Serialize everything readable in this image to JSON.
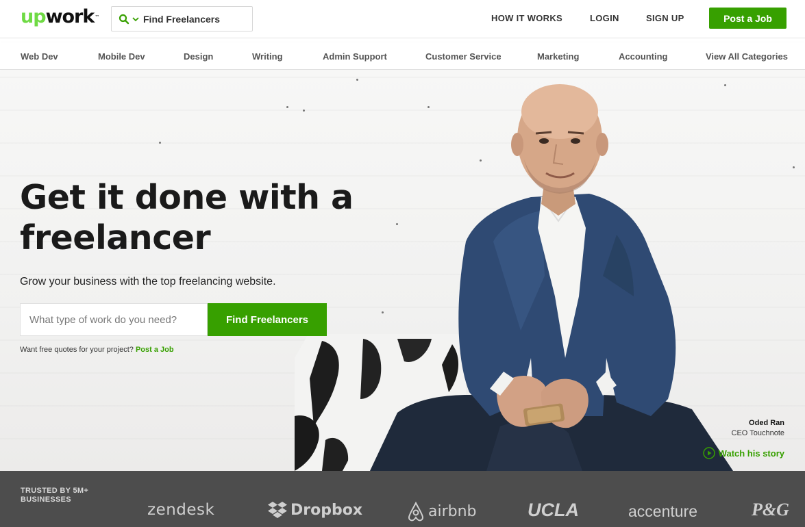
{
  "header": {
    "logo_up": "up",
    "logo_work": "work",
    "logo_tm": "™",
    "search_selector_label": "Find Freelancers",
    "nav": {
      "how_it_works": "HOW IT WORKS",
      "login": "LOGIN",
      "sign_up": "SIGN UP"
    },
    "post_job_label": "Post a Job"
  },
  "categories": [
    "Web Dev",
    "Mobile Dev",
    "Design",
    "Writing",
    "Admin Support",
    "Customer Service",
    "Marketing",
    "Accounting",
    "View All Categories"
  ],
  "hero": {
    "title": "Get it done with a freelancer",
    "subtitle": "Grow your business with the top freelancing website.",
    "search_placeholder": "What type of work do you need?",
    "search_button": "Find Freelancers",
    "quote_text": "Want free quotes for your project?",
    "quote_link": "Post a Job",
    "caption_name": "Oded Ran",
    "caption_role": "CEO Touchnote",
    "watch_label": "Watch his story"
  },
  "trusted": {
    "label": "TRUSTED BY 5M+ BUSINESSES",
    "brands": [
      "zendesk",
      "Dropbox",
      "airbnb",
      "UCLA",
      "accenture",
      "P&G"
    ]
  },
  "colors": {
    "brand_green": "#6fda44",
    "button_green": "#37a000",
    "trusted_bg": "#4d4d4d"
  },
  "icons": {
    "search_selector": "search-icon",
    "search_dropdown": "chevron-down-icon",
    "dropbox": "dropbox-logo-icon",
    "airbnb": "airbnb-logo-icon",
    "watch": "play-circle-icon"
  }
}
